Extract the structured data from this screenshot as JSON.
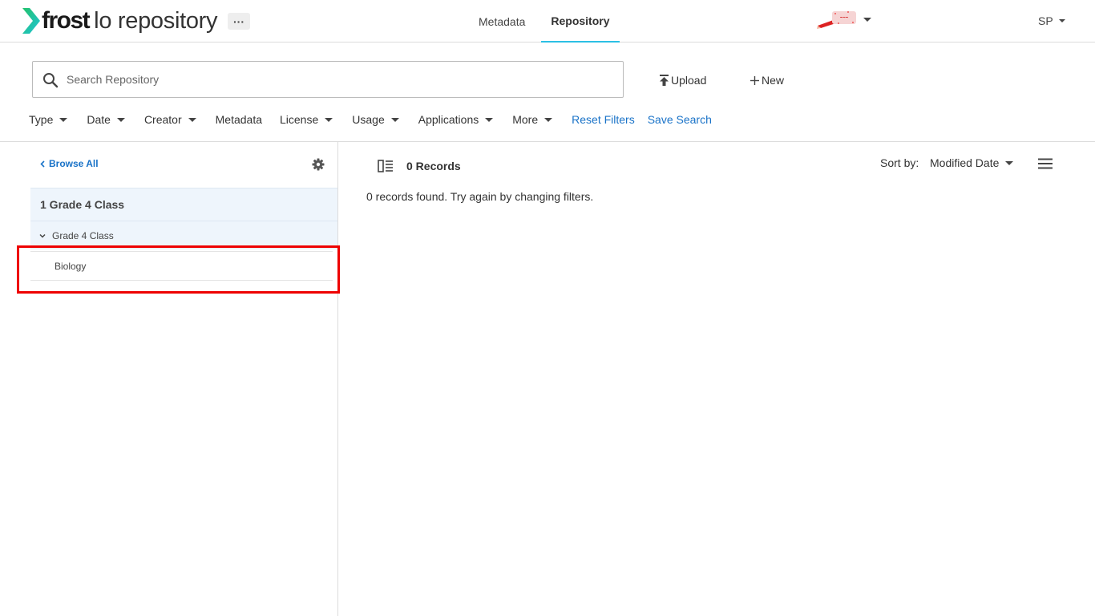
{
  "header": {
    "logo_brand": "frost",
    "logo_product": "lo repository",
    "more_label": "···",
    "nav": [
      {
        "label": "Metadata",
        "active": false
      },
      {
        "label": "Repository",
        "active": true
      }
    ],
    "tenant_logo_icon": "tenant-logo-icon",
    "user_initials": "SP"
  },
  "search": {
    "placeholder": "Search Repository",
    "value": ""
  },
  "actions": {
    "upload_label": "Upload",
    "new_label": "New"
  },
  "filters": {
    "items": [
      "Type",
      "Date",
      "Creator",
      "Metadata",
      "License",
      "Usage",
      "Applications",
      "More"
    ],
    "reset_label": "Reset Filters",
    "save_label": "Save Search"
  },
  "sidebar": {
    "browse_all_label": "Browse All",
    "tree": {
      "root_label": "1 Grade 4 Class",
      "child_label": "Grade 4 Class",
      "leaf_label": "Biology"
    }
  },
  "results": {
    "count_label": "0 Records",
    "empty_message": "0 records found. Try again by changing filters.",
    "sort_label": "Sort by:",
    "sort_value": "Modified Date"
  },
  "colors": {
    "accent": "#2bc0e4",
    "link": "#1a73c8",
    "tree_bg": "#eef5fc",
    "highlight": "#ee0000",
    "logo_arrow": "#22c9a3"
  }
}
